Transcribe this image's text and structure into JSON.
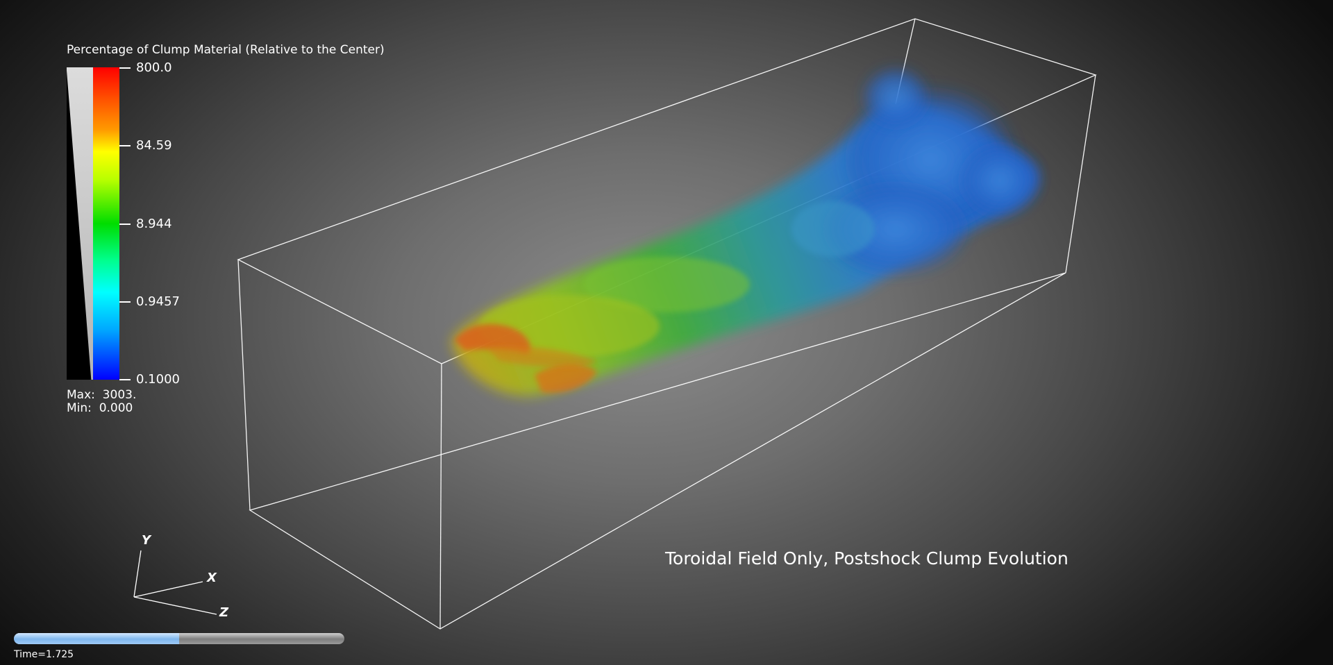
{
  "colorbar": {
    "title": "Percentage of Clump Material (Relative to the Center)",
    "ticks": [
      "800.0",
      "84.59",
      "8.944",
      "0.9457",
      "0.1000"
    ],
    "max_label": "Max:  3003.",
    "min_label": "Min:  0.000",
    "scale": "log",
    "colormap": [
      "#ff0000",
      "#ffff00",
      "#00dd00",
      "#00ffff",
      "#0000ff"
    ]
  },
  "caption": "Toroidal Field Only, Postshock Clump Evolution",
  "axes": {
    "y": "Y",
    "x": "X",
    "z": "Z"
  },
  "time": {
    "label": "Time=1.725",
    "progress": 0.5
  },
  "colors": {
    "box_edges": "#ffffff",
    "plume_core": "#a8c61e",
    "plume_tail": "#2f7fd6",
    "plume_front": "#ff5a00"
  }
}
